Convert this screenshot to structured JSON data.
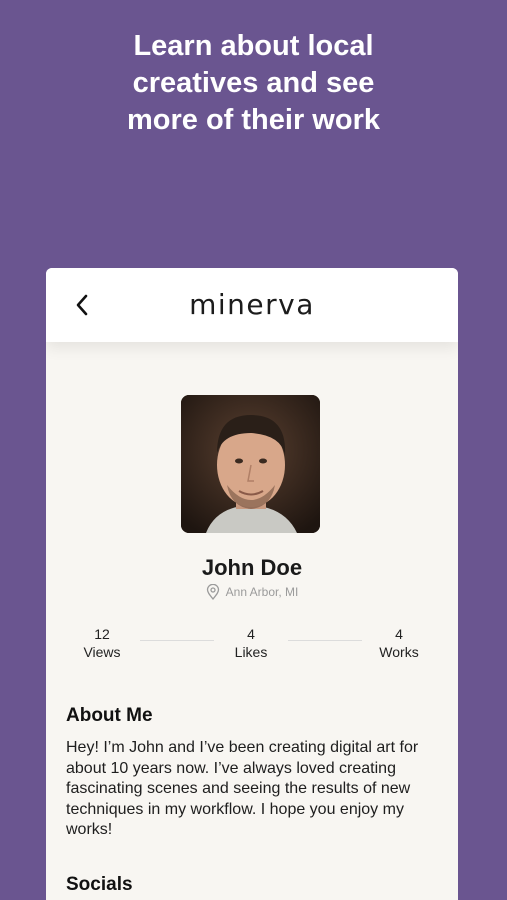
{
  "headline": {
    "line1": "Learn about local",
    "line2": "creatives and see",
    "line3": "more of their work"
  },
  "app": {
    "brand": "minerva"
  },
  "profile": {
    "name": "John Doe",
    "location": "Ann Arbor, MI"
  },
  "stats": {
    "views": {
      "value": "12",
      "label": "Views"
    },
    "likes": {
      "value": "4",
      "label": "Likes"
    },
    "works": {
      "value": "4",
      "label": "Works"
    }
  },
  "about": {
    "title": "About Me",
    "text": "Hey! I’m John and I’ve been creating digital art for about 10 years now. I’ve always loved creating fascinating scenes and seeing the results of new techniques in my workflow. I hope you enjoy my works!"
  },
  "socials": {
    "title": "Socials"
  },
  "colors": {
    "background": "#6a5590",
    "card": "#f8f6f2",
    "appbar": "#ffffff"
  }
}
